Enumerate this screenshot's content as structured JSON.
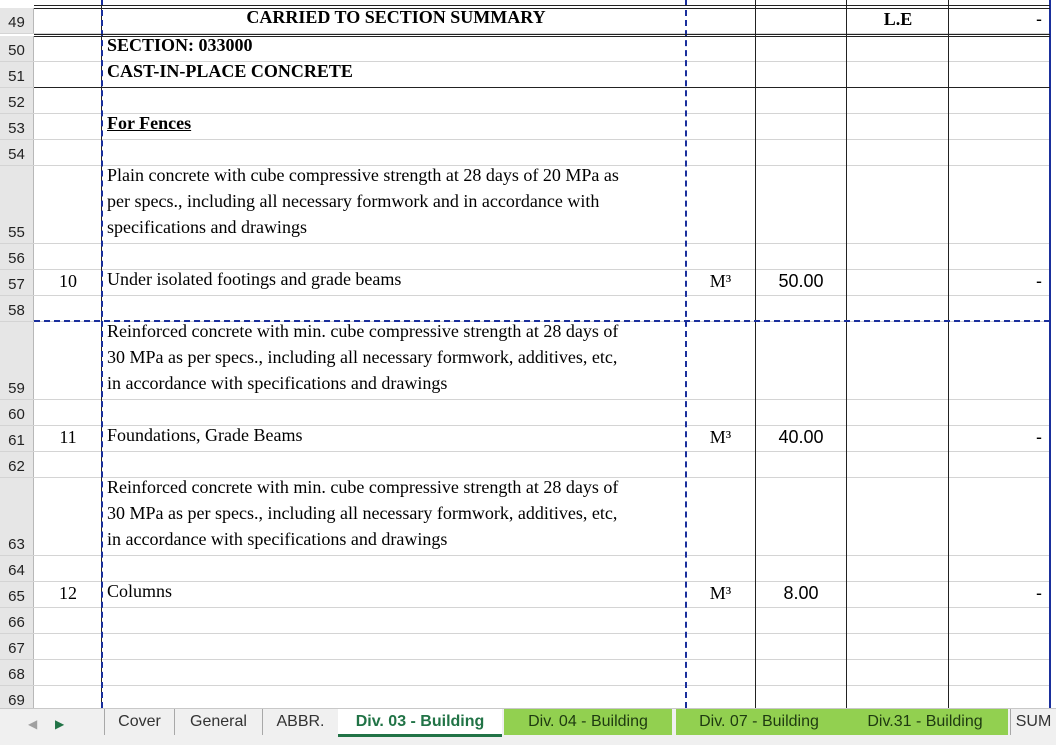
{
  "rows": [
    {
      "num": "49",
      "item": "",
      "desc": "CARRIED TO SECTION SUMMARY",
      "unit": "",
      "qty": "",
      "rate": "L.E",
      "amount": "-"
    },
    {
      "num": "50",
      "item": "",
      "desc": "SECTION:  033000",
      "unit": "",
      "qty": "",
      "rate": "",
      "amount": ""
    },
    {
      "num": "51",
      "item": "",
      "desc": "CAST-IN-PLACE CONCRETE",
      "unit": "",
      "qty": "",
      "rate": "",
      "amount": ""
    },
    {
      "num": "52",
      "item": "",
      "desc": "",
      "unit": "",
      "qty": "",
      "rate": "",
      "amount": ""
    },
    {
      "num": "53",
      "item": "",
      "desc": "For Fences",
      "unit": "",
      "qty": "",
      "rate": "",
      "amount": ""
    },
    {
      "num": "54",
      "item": "",
      "desc": "",
      "unit": "",
      "qty": "",
      "rate": "",
      "amount": ""
    },
    {
      "num": "55",
      "item": "",
      "desc": "Plain concrete with cube compressive strength at 28 days of 20 MPa as\nper specs., including all necessary formwork and in accordance with\nspecifications and drawings",
      "unit": "",
      "qty": "",
      "rate": "",
      "amount": ""
    },
    {
      "num": "56",
      "item": "",
      "desc": "",
      "unit": "",
      "qty": "",
      "rate": "",
      "amount": ""
    },
    {
      "num": "57",
      "item": "10",
      "desc": "Under isolated footings and grade beams",
      "unit": "M³",
      "qty": "50.00",
      "rate": "",
      "amount": "-"
    },
    {
      "num": "58",
      "item": "",
      "desc": "",
      "unit": "",
      "qty": "",
      "rate": "",
      "amount": ""
    },
    {
      "num": "59",
      "item": "",
      "desc": "Reinforced concrete with min. cube compressive strength at 28 days of\n30 MPa as per specs., including all necessary formwork, additives, etc,\nin accordance with specifications and drawings",
      "unit": "",
      "qty": "",
      "rate": "",
      "amount": ""
    },
    {
      "num": "60",
      "item": "",
      "desc": "",
      "unit": "",
      "qty": "",
      "rate": "",
      "amount": ""
    },
    {
      "num": "61",
      "item": "11",
      "desc": "Foundations, Grade Beams",
      "unit": "M³",
      "qty": "40.00",
      "rate": "",
      "amount": "-"
    },
    {
      "num": "62",
      "item": "",
      "desc": "",
      "unit": "",
      "qty": "",
      "rate": "",
      "amount": ""
    },
    {
      "num": "63",
      "item": "",
      "desc": "Reinforced concrete with min. cube compressive strength at 28 days of\n30 MPa as per specs., including all necessary formwork, additives, etc,\nin accordance with specifications and drawings",
      "unit": "",
      "qty": "",
      "rate": "",
      "amount": ""
    },
    {
      "num": "64",
      "item": "",
      "desc": "",
      "unit": "",
      "qty": "",
      "rate": "",
      "amount": ""
    },
    {
      "num": "65",
      "item": "12",
      "desc": "Columns",
      "unit": "M³",
      "qty": "8.00",
      "rate": "",
      "amount": "-"
    },
    {
      "num": "66",
      "item": "",
      "desc": "",
      "unit": "",
      "qty": "",
      "rate": "",
      "amount": ""
    },
    {
      "num": "67",
      "item": "",
      "desc": "",
      "unit": "",
      "qty": "",
      "rate": "",
      "amount": ""
    },
    {
      "num": "68",
      "item": "",
      "desc": "",
      "unit": "",
      "qty": "",
      "rate": "",
      "amount": ""
    },
    {
      "num": "69",
      "item": "",
      "desc": "",
      "unit": "",
      "qty": "",
      "rate": "",
      "amount": ""
    }
  ],
  "tabs": [
    {
      "label": "Cover",
      "style": "plain"
    },
    {
      "label": "General",
      "style": "plain"
    },
    {
      "label": "ABBR.",
      "style": "plain"
    },
    {
      "label": "Div. 03 - Building",
      "style": "active"
    },
    {
      "label": "Div. 04 - Building",
      "style": "green"
    },
    {
      "label": "Div. 07 - Building",
      "style": "green"
    },
    {
      "label": "Div.31 - Building",
      "style": "green"
    },
    {
      "label": "SUM",
      "style": "plain"
    }
  ],
  "nav": {
    "prev_icon": "triangle-left-icon",
    "next_icon": "triangle-right-icon"
  },
  "colors": {
    "tab_green": "#92d050",
    "active_tab_text": "#217346",
    "border_blue": "#1a2f9c",
    "header_gray": "#e6e6e6"
  }
}
